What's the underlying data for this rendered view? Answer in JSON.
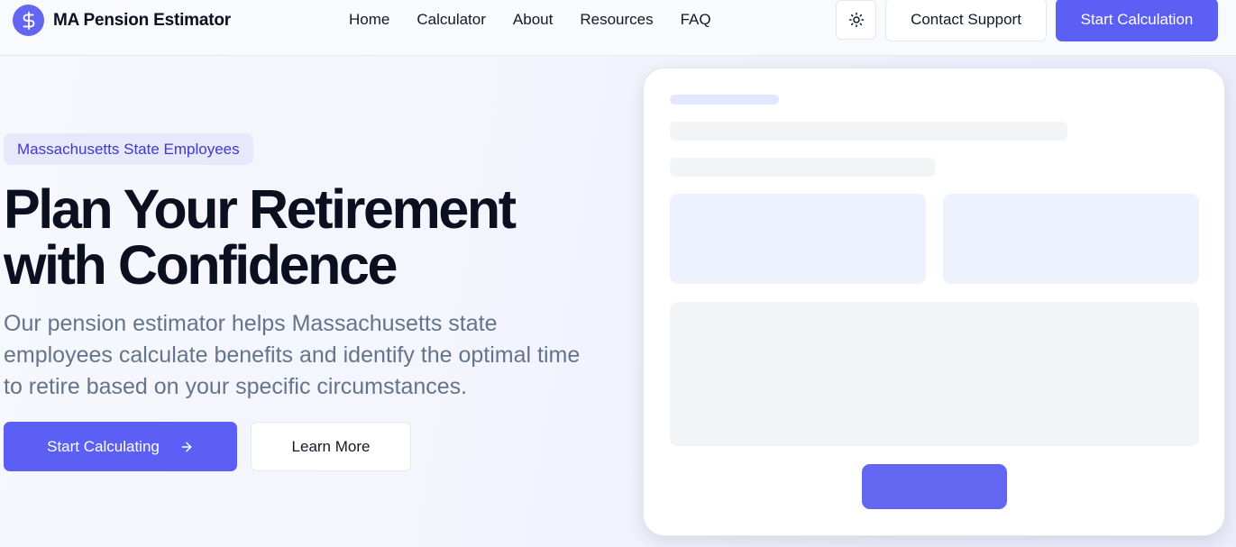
{
  "brand": {
    "name": "MA Pension Estimator",
    "logo_icon": "dollar-sign-icon",
    "accent_color": "#6366f1"
  },
  "nav": {
    "items": [
      {
        "label": "Home"
      },
      {
        "label": "Calculator"
      },
      {
        "label": "About"
      },
      {
        "label": "Resources"
      },
      {
        "label": "FAQ"
      }
    ]
  },
  "header": {
    "theme_toggle_icon": "sun-icon",
    "contact_label": "Contact Support",
    "start_label": "Start Calculation"
  },
  "hero": {
    "badge": "Massachusetts State Employees",
    "title_line1": "Plan Your Retirement",
    "title_line2": "with Confidence",
    "description": "Our pension estimator helps Massachusetts state employees calculate benefits and identify the optimal time to retire based on your specific circumstances.",
    "primary_cta": "Start Calculating",
    "primary_cta_icon": "arrow-right-icon",
    "secondary_cta": "Learn More"
  },
  "preview_card": {
    "state": "loading-skeleton",
    "accent_color": "#6366f1"
  }
}
